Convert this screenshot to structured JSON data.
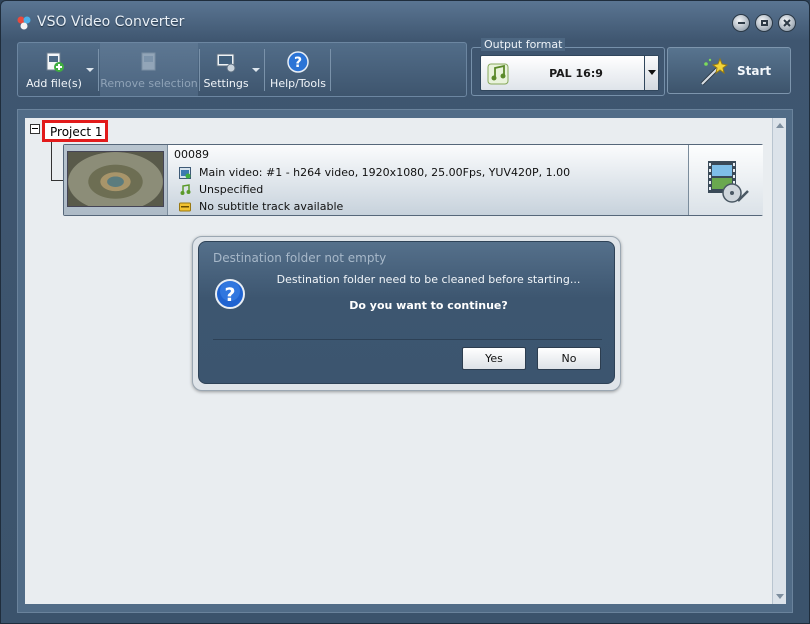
{
  "window": {
    "title": "VSO Video Converter"
  },
  "toolbar": {
    "add_files": "Add file(s)",
    "remove_selection": "Remove selection",
    "settings": "Settings",
    "help_tools": "Help/Tools"
  },
  "output_format": {
    "label": "Output format",
    "value": "PAL 16:9"
  },
  "start_label": "Start",
  "project": {
    "name": "Project 1"
  },
  "file": {
    "name": "00089",
    "video": "Main video: #1 - h264 video, 1920x1080, 25.00Fps, YUV420P, 1.00",
    "audio": "Unspecified",
    "subtitle": "No subtitle track available"
  },
  "dialog": {
    "title": "Destination folder not empty",
    "message": "Destination folder need to be cleaned before starting...",
    "question": "Do you want to continue?",
    "yes": "Yes",
    "no": "No"
  },
  "colors": {
    "highlight_border": "#e21b1b",
    "panel_bg": "#e9edf0",
    "chrome": "#3b536c"
  }
}
